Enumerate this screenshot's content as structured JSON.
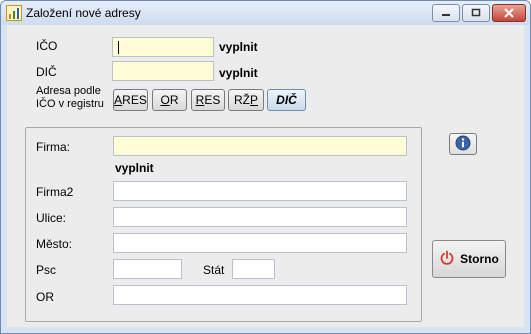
{
  "window": {
    "title": "Založení nové adresy",
    "icon": "chart-icon"
  },
  "header": {
    "ico_label": "IČO",
    "ico_value": "",
    "ico_hint": "vyplnit",
    "dic_label": "DIČ",
    "dic_value": "",
    "dic_hint": "vyplnit",
    "registry_label_line1": "Adresa podle",
    "registry_label_line2": "IČO v registru",
    "registry_buttons": [
      {
        "pre": "",
        "acc": "A",
        "post": "RES"
      },
      {
        "pre": "",
        "acc": "O",
        "post": "R"
      },
      {
        "pre": "",
        "acc": "R",
        "post": "ES"
      },
      {
        "pre": "RŽ",
        "acc": "P",
        "post": ""
      },
      {
        "pre": "DIČ",
        "acc": "",
        "post": ""
      }
    ]
  },
  "form": {
    "firma_label": "Firma:",
    "firma_value": "",
    "firma_hint": "vyplnit",
    "firma2_label": "Firma2",
    "firma2_value": "",
    "ulice_label": "Ulice:",
    "ulice_value": "",
    "mesto_label": "Město:",
    "mesto_value": "",
    "psc_label": "Psc",
    "psc_value": "",
    "stat_label": "Stát",
    "stat_value": "",
    "or_label": "OR",
    "or_value": ""
  },
  "actions": {
    "info_icon": "info-icon",
    "storno_label": "Storno",
    "storno_icon": "power-icon"
  },
  "colors": {
    "required_field": "#fffdd6",
    "storno_icon": "#d23b2a",
    "info_icon": "#3b63a8"
  }
}
